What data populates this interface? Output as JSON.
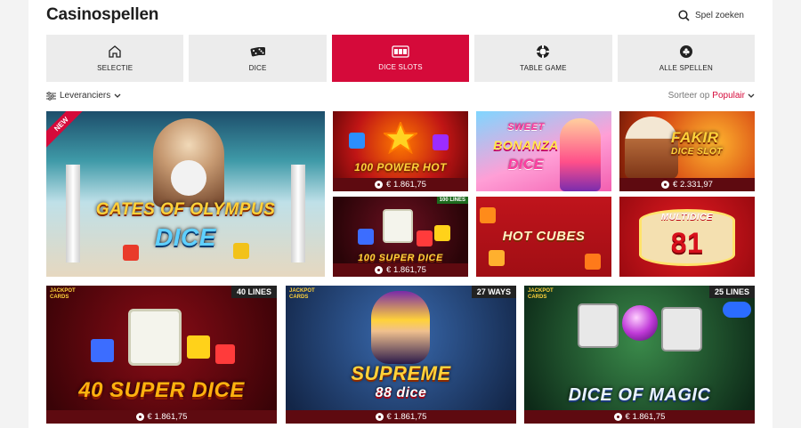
{
  "header": {
    "title": "Casinospellen",
    "search_label": "Spel zoeken"
  },
  "tabs": [
    {
      "label": "SELECTIE",
      "icon": "house-icon",
      "active": false
    },
    {
      "label": "DICE",
      "icon": "dice-icon",
      "active": false
    },
    {
      "label": "DICE SLOTS",
      "icon": "slot-machine-icon",
      "active": true
    },
    {
      "label": "TABLE GAME",
      "icon": "poker-chip-icon",
      "active": false
    },
    {
      "label": "ALLE SPELLEN",
      "icon": "club-chip-icon",
      "active": false
    }
  ],
  "filters": {
    "providers_label": "Leveranciers",
    "sort_label": "Sorteer op",
    "sort_value": "Populair"
  },
  "colors": {
    "accent": "#d50a3a",
    "footer": "#5e0a10"
  },
  "games": {
    "gates": {
      "title_line1": "GATES OF OLYMPUS",
      "title_line2": "DICE",
      "badge": "NEW"
    },
    "power": {
      "title": "100 POWER HOT",
      "jackpot": "€ 1.861,75"
    },
    "bonanza": {
      "title_line1": "SWEET",
      "title_line2": "BONANZA",
      "title_line3": "DICE"
    },
    "fakir": {
      "title_line1": "FAKIR",
      "title_line2": "DICE SLOT",
      "jackpot": "€ 2.331,97"
    },
    "super100": {
      "title": "100 SUPER DICE",
      "jackpot": "€ 1.861,75",
      "lines": "100 LINES"
    },
    "hotcubes": {
      "title": "HOT CUBES"
    },
    "multidice": {
      "title_line1": "MULTIDICE",
      "title_line2": "81"
    },
    "super40": {
      "title": "40 SUPER DICE",
      "jackpot": "€ 1.861,75",
      "lines": "40 LINES",
      "brand": "JACKPOT CARDS"
    },
    "supreme": {
      "title_line1": "SUPREME",
      "title_line2": "88 dice",
      "jackpot": "€ 1.861,75",
      "lines": "27 WAYS",
      "brand": "JACKPOT CARDS"
    },
    "magic": {
      "title": "DICE OF MAGIC",
      "jackpot": "€ 1.861,75",
      "lines": "25 LINES",
      "brand": "JACKPOT CARDS"
    }
  }
}
